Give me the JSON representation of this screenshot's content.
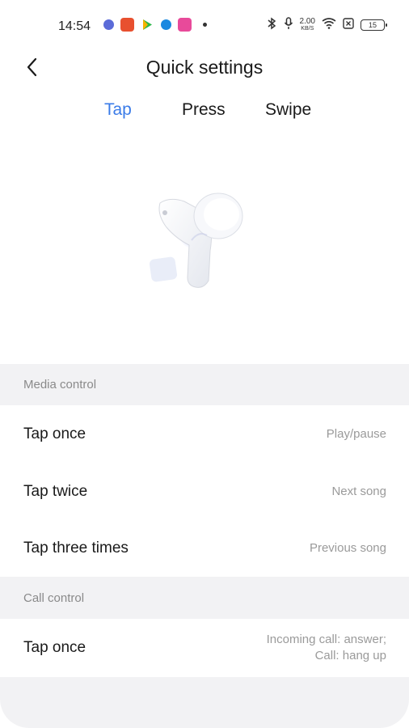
{
  "status_bar": {
    "time": "14:54",
    "net_speed_value": "2.00",
    "net_speed_unit": "KB/S",
    "battery": "15",
    "app_icon_colors": [
      "#5b6bd8",
      "#e8502f",
      "#2db84b",
      "#1a88e0",
      "#e84a9a"
    ]
  },
  "header": {
    "title": "Quick settings",
    "back_icon": "chevron-left-icon"
  },
  "tabs": [
    {
      "label": "Tap",
      "active": true
    },
    {
      "label": "Press",
      "active": false
    },
    {
      "label": "Swipe",
      "active": false
    }
  ],
  "accent_color": "#3a7be8",
  "sections": [
    {
      "title": "Media control",
      "rows": [
        {
          "label": "Tap once",
          "value": "Play/pause"
        },
        {
          "label": "Tap twice",
          "value": "Next song"
        },
        {
          "label": "Tap three times",
          "value": "Previous song"
        }
      ]
    },
    {
      "title": "Call control",
      "rows": [
        {
          "label": "Tap once",
          "value_line1": "Incoming call: answer;",
          "value_line2": "Call: hang up"
        }
      ]
    }
  ]
}
